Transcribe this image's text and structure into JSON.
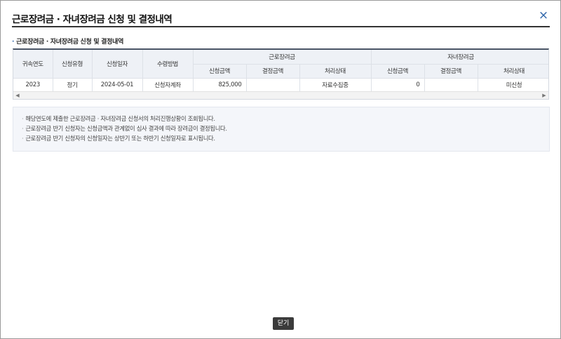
{
  "dialog": {
    "title": "근로장려금 · 자녀장려금 신청 및 결정내역",
    "close_icon": "×"
  },
  "section": {
    "bullet": "·",
    "title": "근로장려금 · 자녀장려금 신청 및 결정내역"
  },
  "table": {
    "headers": {
      "year": "귀속연도",
      "type": "신청유형",
      "date": "신청일자",
      "method": "수령방법",
      "eitc_group": "근로장려금",
      "ctc_group": "자녀장려금",
      "applied_amount": "신청금액",
      "decided_amount": "결정금액",
      "status": "처리상태"
    },
    "rows": [
      {
        "year": "2023",
        "type": "정기",
        "date": "2024-05-01",
        "method": "신청자계좌",
        "eitc_applied": "825,000",
        "eitc_decided": "",
        "eitc_status": "자료수집중",
        "ctc_applied": "0",
        "ctc_decided": "",
        "ctc_status": "미신청"
      }
    ]
  },
  "scrollbar": {
    "left_arrow": "◀",
    "right_arrow": "▶"
  },
  "notes": {
    "bullet": "·",
    "lines": [
      "해당연도에 제출한 근로장려금 · 자녀장려금 신청서의 처리진행상황이 조회됩니다.",
      "근로장려금 반기 신청자는 신청금액과 관계없이 심사 결과에 따라 장려금이 결정됩니다.",
      "근로장려금 반기 신청자의 신청일자는 상반기 또는 하반기 신청일자로 표시됩니다."
    ]
  },
  "footer": {
    "close_label": "닫기"
  }
}
